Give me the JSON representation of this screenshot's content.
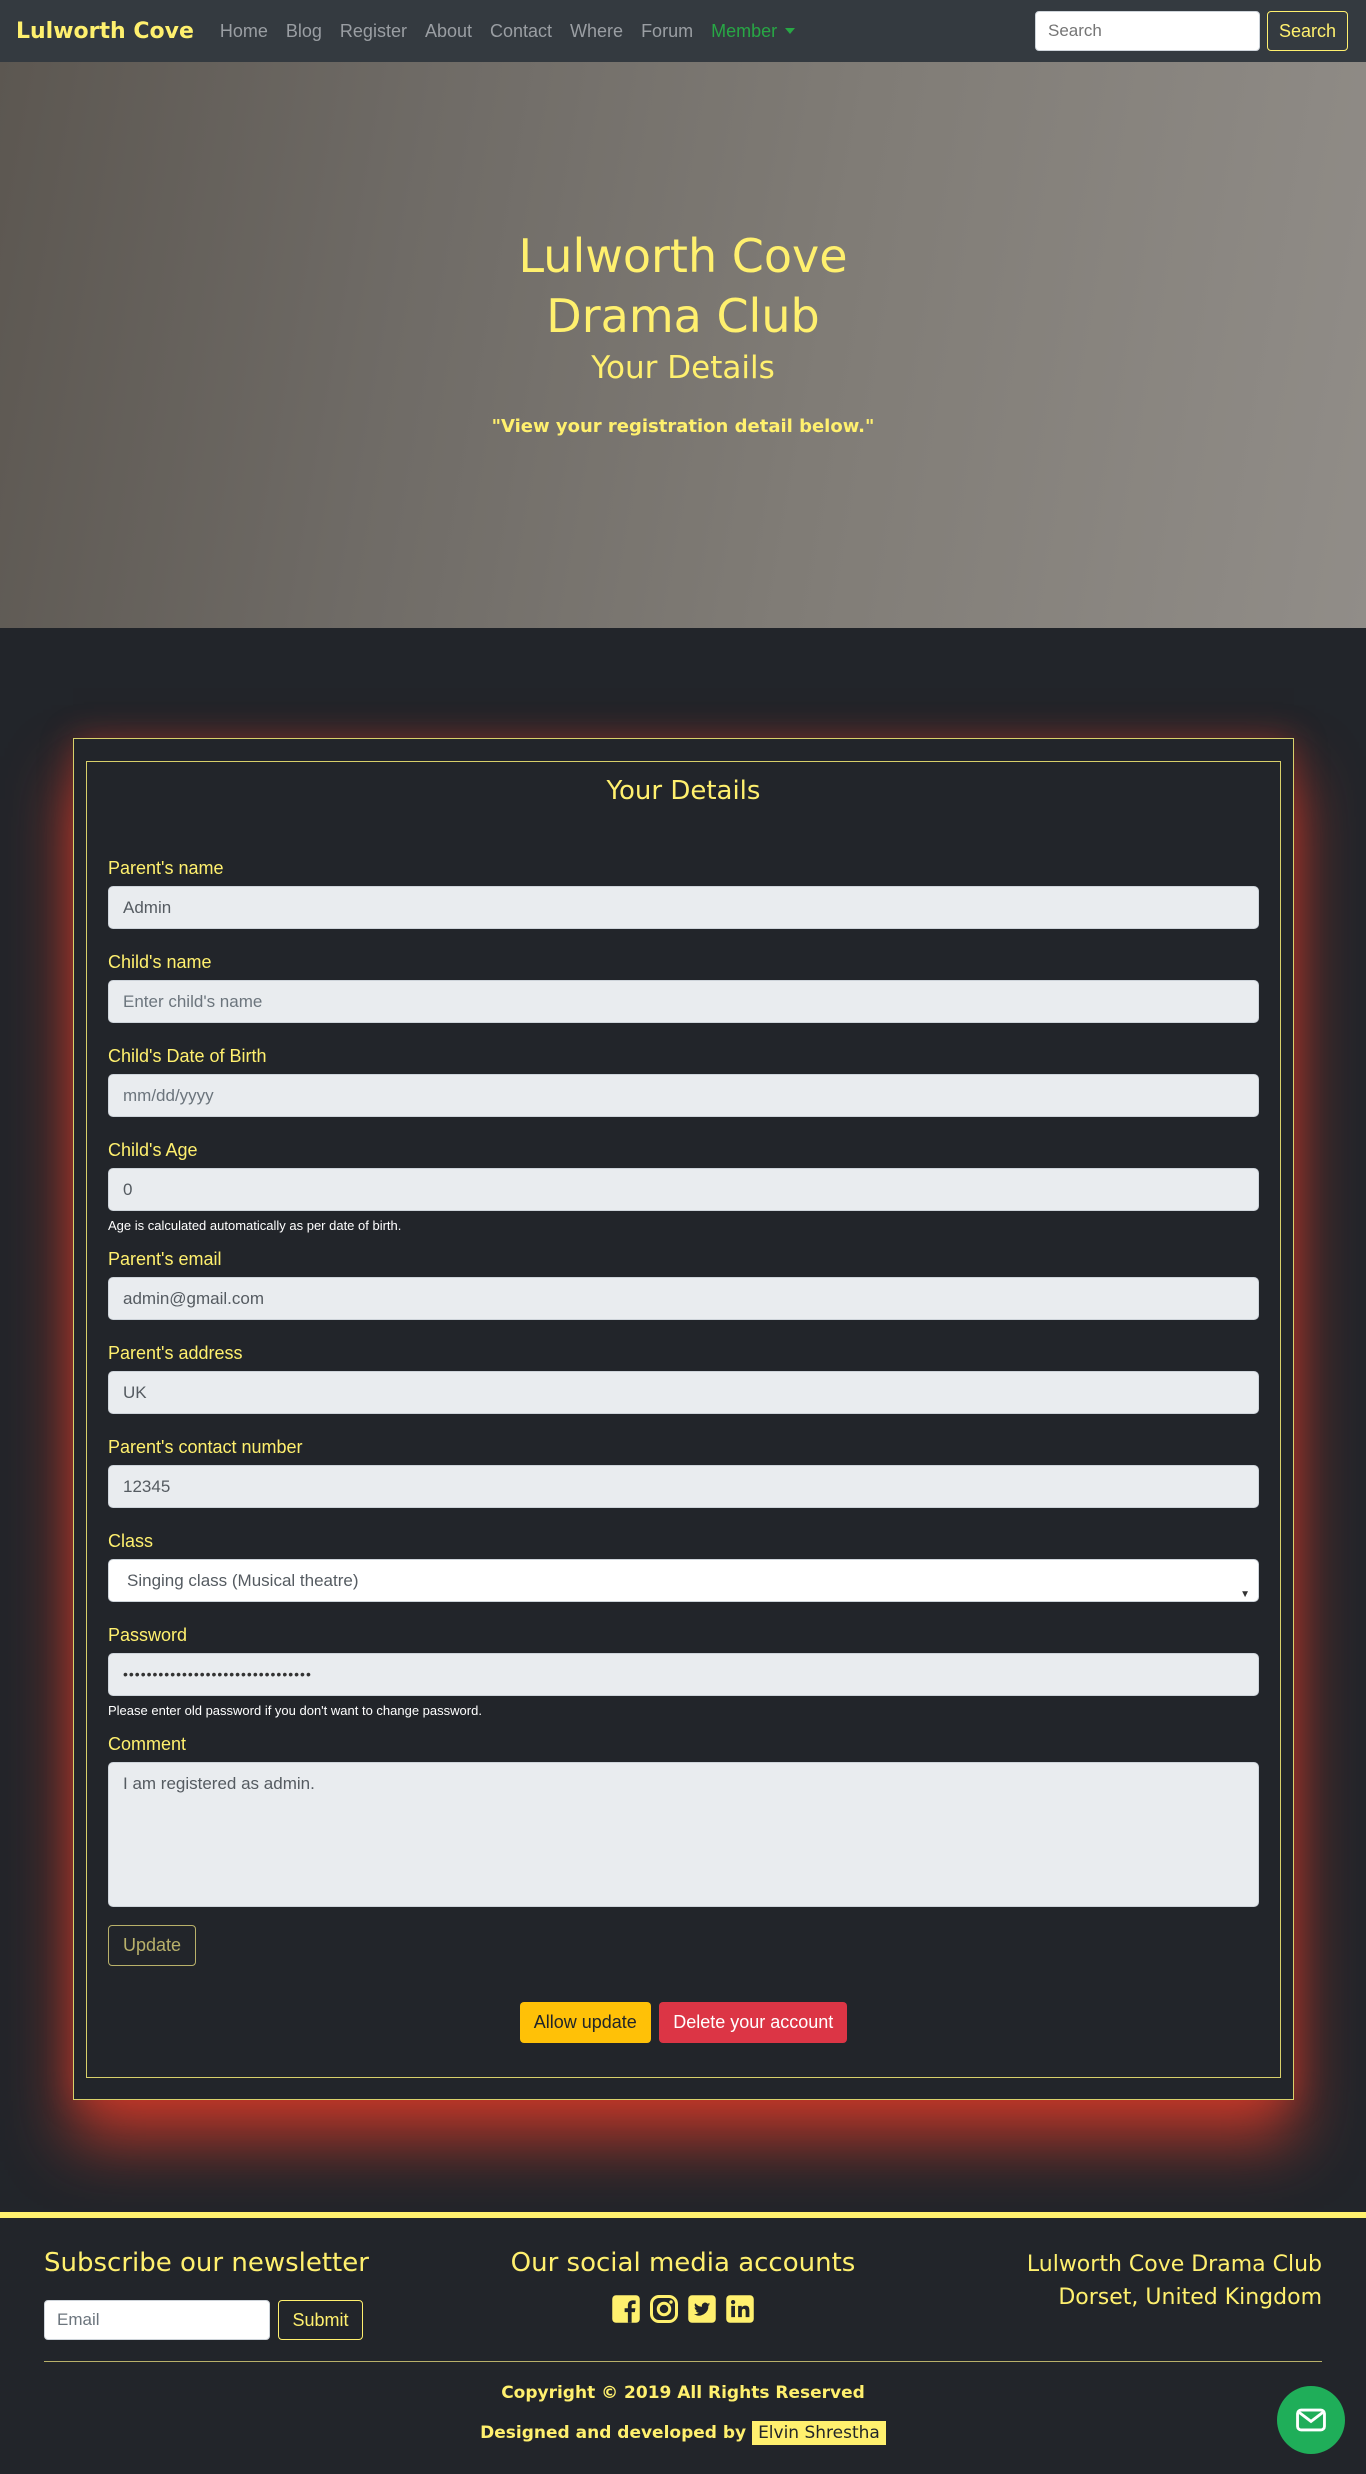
{
  "navbar": {
    "brand": "Lulworth Cove",
    "links": [
      "Home",
      "Blog",
      "Register",
      "About",
      "Contact",
      "Where",
      "Forum"
    ],
    "member_label": "Member",
    "search_placeholder": "Search",
    "search_button": "Search"
  },
  "hero": {
    "title_line1": "Lulworth Cove",
    "title_line2": "Drama Club",
    "subtitle": "Your Details",
    "quote": "\"View your registration detail below.\""
  },
  "form": {
    "title": "Your Details",
    "parent_name": {
      "label": "Parent's name",
      "value": "Admin"
    },
    "child_name": {
      "label": "Child's name",
      "placeholder": "Enter child's name"
    },
    "child_dob": {
      "label": "Child's Date of Birth",
      "placeholder": "mm/dd/yyyy"
    },
    "child_age": {
      "label": "Child's Age",
      "value": "0",
      "help": "Age is calculated automatically as per date of birth."
    },
    "parent_email": {
      "label": "Parent's email",
      "value": "admin@gmail.com"
    },
    "parent_address": {
      "label": "Parent's address",
      "value": "UK"
    },
    "parent_contact": {
      "label": "Parent's contact number",
      "value": "12345"
    },
    "class": {
      "label": "Class",
      "value": "Singing class (Musical theatre)"
    },
    "password": {
      "label": "Password",
      "value": "••••••••••••••••••••••••••••••••",
      "help": "Please enter old password if you don't want to change password."
    },
    "comment": {
      "label": "Comment",
      "value": "I am registered as admin."
    },
    "update_button": "Update",
    "allow_update_button": "Allow update",
    "delete_button": "Delete your account"
  },
  "footer": {
    "newsletter_title": "Subscribe our newsletter",
    "email_placeholder": "Email",
    "submit_button": "Submit",
    "social_title": "Our social media accounts",
    "social_icons": [
      "facebook-icon",
      "instagram-icon",
      "twitter-icon",
      "linkedin-icon"
    ],
    "club_name": "Lulworth Cove Drama Club",
    "club_location": "Dorset, United Kingdom",
    "copyright": "Copyright © 2019 All Rights Reserved",
    "designed_by_prefix": "Designed and developed by",
    "designer_name": "Elvin Shrestha"
  },
  "colors": {
    "accent": "#fff06e",
    "background": "#22252a",
    "navbar": "#343a40",
    "danger": "#dc3545",
    "warning": "#ffc107",
    "success": "#28a745"
  }
}
